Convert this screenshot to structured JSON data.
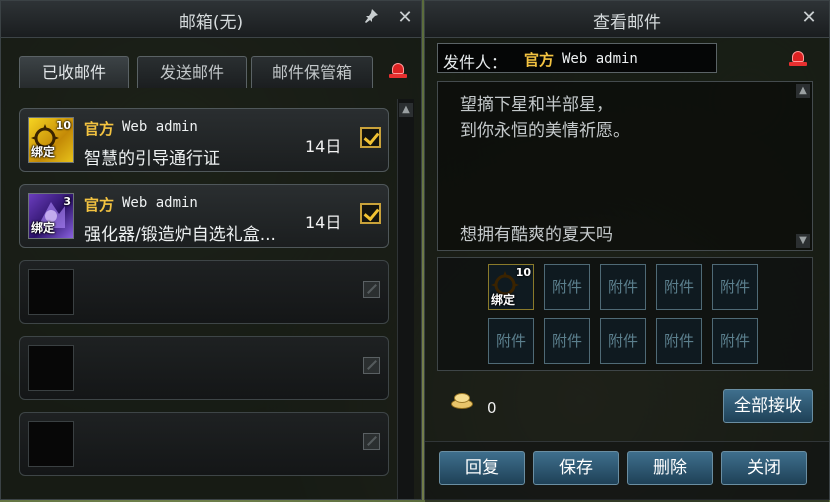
{
  "inbox_window": {
    "title": "邮箱(无)",
    "pin_icon": "pin-icon",
    "close_label": "✕",
    "tabs": [
      {
        "label": "已收邮件",
        "active": true
      },
      {
        "label": "发送邮件",
        "active": false
      },
      {
        "label": "邮件保管箱",
        "active": false
      }
    ],
    "mails": [
      {
        "sender_tag": "官方",
        "sender_name": "Web admin",
        "subject": "智慧的引导通行证",
        "days": "14日",
        "item_count": "10",
        "item_tag": "绑定",
        "item_color": "gold",
        "checked": true
      },
      {
        "sender_tag": "官方",
        "sender_name": "Web admin",
        "subject": "强化器/锻造炉自选礼盒...",
        "days": "14日",
        "item_count": "3",
        "item_tag": "绑定",
        "item_color": "purple",
        "checked": true
      }
    ],
    "empty_slots": 3
  },
  "view_window": {
    "title": "查看邮件",
    "close_label": "✕",
    "sender_label": "发件人：",
    "sender_tag": "官方",
    "sender_name": "Web admin",
    "body_lines": [
      "望摘下星和半部星，",
      "到你永恒的美情祈愿。",
      "",
      "",
      "",
      "想拥有酷爽的夏天吗"
    ],
    "attachment": {
      "count": "10",
      "tag": "绑定"
    },
    "attachment_placeholder": "附件",
    "gold_amount": "0",
    "receive_all_label": "全部接收",
    "buttons": {
      "reply": "回复",
      "save": "保存",
      "delete": "删除",
      "close": "关闭"
    }
  },
  "colors": {
    "accent_gold": "#f3c341",
    "button_blue": "#2f5a75"
  }
}
